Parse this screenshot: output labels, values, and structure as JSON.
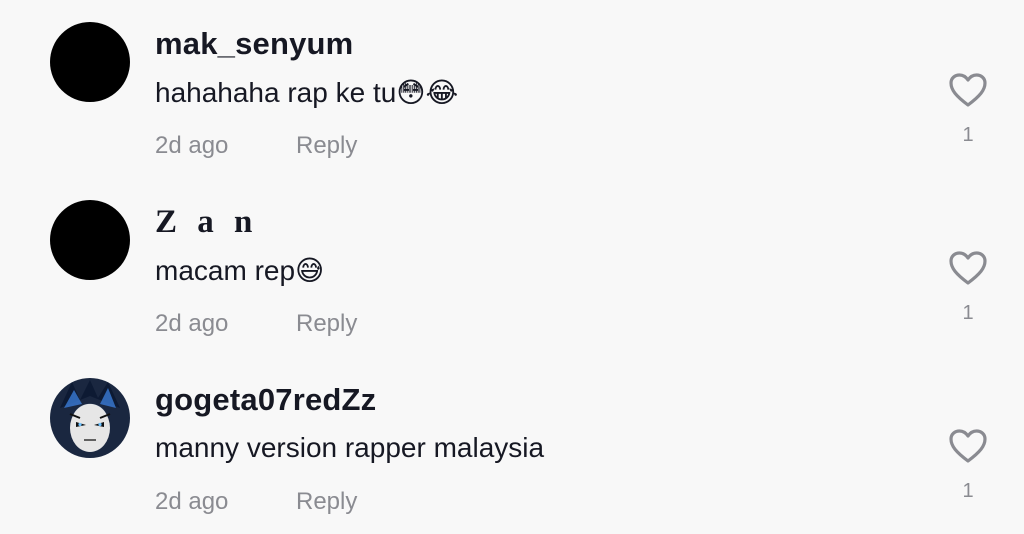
{
  "comments": [
    {
      "username": "mak_senyum",
      "text": "hahahaha rap ke tu😳😂",
      "time": "2d ago",
      "reply_label": "Reply",
      "likes": "1"
    },
    {
      "username": "Z a n",
      "text": "macam rep😅",
      "time": "2d ago",
      "reply_label": "Reply",
      "likes": "1"
    },
    {
      "username": "gogeta07redZz",
      "text": "manny version rapper malaysia",
      "time": "2d ago",
      "reply_label": "Reply",
      "likes": "1"
    }
  ],
  "icons": {
    "like": "heart-outline-icon"
  },
  "colors": {
    "background": "#f8f8f8",
    "primary_text": "#161823",
    "secondary_text": "#8a8b91"
  }
}
